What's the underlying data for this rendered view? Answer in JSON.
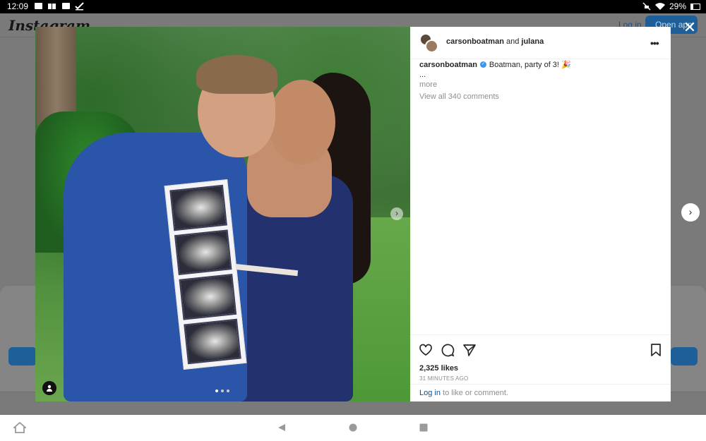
{
  "status_bar": {
    "time": "12:09",
    "battery": "29%"
  },
  "background": {
    "logo": "Instagram",
    "login_label": "Log in",
    "open_app_label": "Open app"
  },
  "post": {
    "header": {
      "username": "carsonboatman",
      "joiner": "and",
      "collaborator": "julana"
    },
    "caption": {
      "username": "carsonboatman",
      "text": "Boatman, party of 3! 🎉",
      "ellipsis": "...",
      "more_label": "more",
      "view_all_comments": "View all 340 comments"
    },
    "likes": "2,325 likes",
    "time_ago": "31 MINUTES AGO",
    "login_prompt": {
      "link": "Log in",
      "text": " to like or comment."
    },
    "carousel": {
      "slide_count": 3,
      "active_slide": 1
    }
  },
  "colors": {
    "link": "#0a4f8c",
    "verified": "#3897f0",
    "open_app_button": "#1e5f99"
  }
}
